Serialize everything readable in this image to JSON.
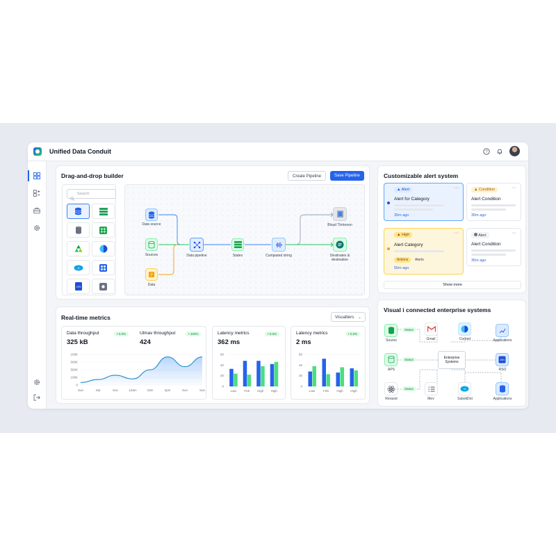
{
  "app": {
    "title": "Unified Data Conduit"
  },
  "builder": {
    "title": "Drag-and-drop builder",
    "create_label": "Create Pipeline",
    "save_label": "Save Pipeline",
    "search_placeholder": "Search",
    "nodes": [
      {
        "label": "Data source"
      },
      {
        "label": "Sources"
      },
      {
        "label": "Data"
      },
      {
        "label": "Data pipeline"
      },
      {
        "label": "States"
      },
      {
        "label": "Cumpiated string"
      },
      {
        "label": "Bloud Thrleroon"
      },
      {
        "label": "Destinates & destination"
      }
    ]
  },
  "metrics": {
    "title": "Real-time metrics",
    "dropdown": "Visualliers",
    "cards": [
      {
        "title": "Data throughput",
        "value": "325 kB",
        "badge": "• 0.0%"
      },
      {
        "title": "Ulmav throughput",
        "value": "424",
        "badge": "• 100%"
      },
      {
        "title": "Latency metrics",
        "value": "362 ms",
        "badge": "• 0.0%"
      },
      {
        "title": "Latency metrics",
        "value": "2 ms",
        "badge": "• 0.0%"
      }
    ]
  },
  "chart_data": [
    {
      "type": "area",
      "x": [
        "Sun",
        "Sat",
        "Sun",
        "12am",
        "15m",
        "2pm",
        "Sun",
        "Sun"
      ],
      "y_ticks": [
        "100K",
        "500K",
        "500K",
        "100K",
        "0"
      ],
      "values": [
        4,
        9,
        16,
        10,
        25,
        46,
        30,
        46
      ]
    },
    {
      "type": "bar",
      "categories": [
        "Law",
        "Feb",
        "High",
        "High"
      ],
      "y_ticks": [
        "60",
        "40",
        "20",
        "0"
      ],
      "series": [
        {
          "values": [
            33,
            48,
            48,
            42
          ]
        },
        {
          "values": [
            24,
            22,
            38,
            46
          ]
        }
      ],
      "ylim": [
        0,
        60
      ]
    },
    {
      "type": "bar",
      "categories": [
        "Law",
        "Feb",
        "High",
        "High"
      ],
      "y_ticks": [
        "60",
        "40",
        "20",
        "0"
      ],
      "series": [
        {
          "values": [
            28,
            52,
            26,
            34
          ]
        },
        {
          "values": [
            38,
            23,
            36,
            30
          ]
        }
      ],
      "ylim": [
        0,
        60
      ]
    }
  ],
  "alerts": {
    "title": "Customizable alert system",
    "show_more": "Show more",
    "items": [
      {
        "badge": "Alert",
        "title": "Alert for Category",
        "time": "35m ago"
      },
      {
        "badge": "Condition",
        "title": "Alert Condition",
        "time": "35m ago"
      },
      {
        "badge": "High",
        "title": "Alert Category",
        "time": "55m ago",
        "tags": [
          "Actions",
          "Alerts"
        ]
      },
      {
        "badge": "Alert",
        "title": "Alert Condition",
        "time": "35m ago"
      }
    ],
    "colors": {
      "blue": "#2563eb",
      "amber": "#f59e0b",
      "gray": "#6b7280"
    }
  },
  "enterprise": {
    "title": "Visual i connected enterprise systems",
    "hub": "Enterprise Systems",
    "status": "Status",
    "nodes": [
      "Soures",
      "Gmail",
      "Cormet",
      "Applications",
      "APS",
      "RSO",
      "Rerasot",
      "Mev",
      "SubstiDot",
      "Applications"
    ]
  }
}
